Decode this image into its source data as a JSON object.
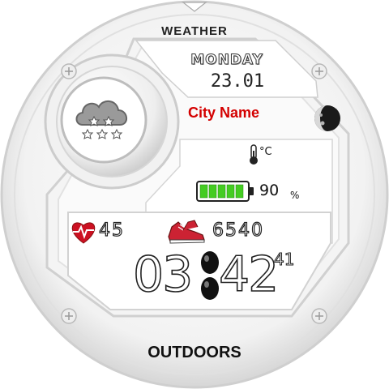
{
  "watch": {
    "top_label": "WEATHER",
    "bottom_label": "OUTDOORS",
    "day": "MONDAY",
    "date": "23.01",
    "city": "City Name",
    "temp_unit": "°C",
    "battery": {
      "level": 0.9,
      "text": "90",
      "percent_sign": "%"
    },
    "heart_rate": "45",
    "steps": "6540",
    "time": {
      "hours": "03",
      "minutes": "42",
      "seconds": "41"
    }
  },
  "colors": {
    "accent_red": "#d40000",
    "battery_green": "#44cc22",
    "heart_red": "#cc1122",
    "shoe_red": "#cc2233"
  },
  "icons": [
    "snow-cloud-icon",
    "moon-phase-icon",
    "thermometer-icon",
    "battery-icon",
    "heart-rate-icon",
    "sneaker-icon",
    "colon-separator-icon",
    "chevron-down-icon",
    "screw-icon"
  ]
}
